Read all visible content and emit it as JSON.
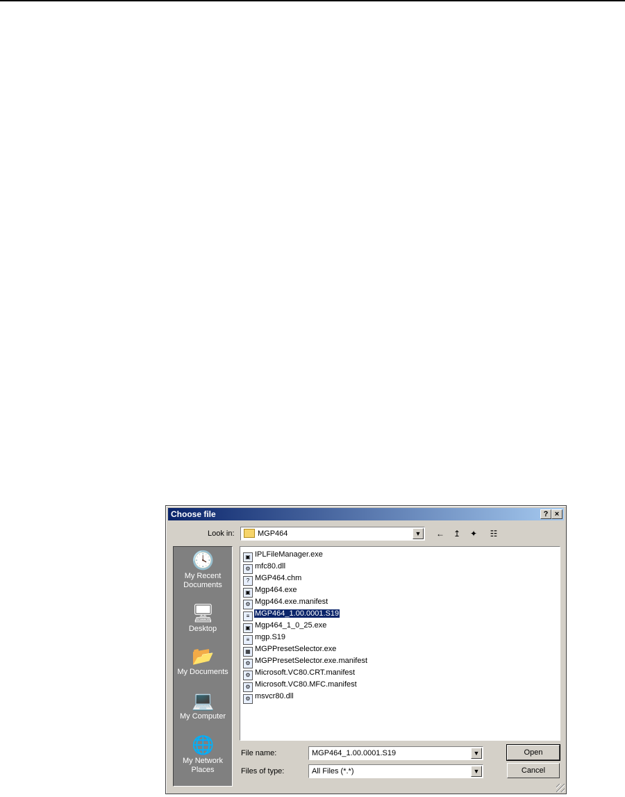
{
  "dialog": {
    "title": "Choose file",
    "help_label": "?",
    "close_label": "×"
  },
  "lookin": {
    "label": "Look in:",
    "value": "MGP464"
  },
  "toolbar": {
    "back_icon": "←",
    "up_icon": "↥",
    "new_folder_icon": "✦",
    "views_icon": "☷"
  },
  "places": [
    {
      "label": "My Recent Documents",
      "icon": "clock-icon"
    },
    {
      "label": "Desktop",
      "icon": "desktop-icon"
    },
    {
      "label": "My Documents",
      "icon": "folder-icon"
    },
    {
      "label": "My Computer",
      "icon": "computer-icon"
    },
    {
      "label": "My Network Places",
      "icon": "globe-icon"
    }
  ],
  "files": [
    {
      "name": "IPLFileManager.exe",
      "icon": "exe"
    },
    {
      "name": "mfc80.dll",
      "icon": "dll"
    },
    {
      "name": "MGP464.chm",
      "icon": "chm"
    },
    {
      "name": "Mgp464.exe",
      "icon": "exe"
    },
    {
      "name": "Mgp464.exe.manifest",
      "icon": "manifest"
    },
    {
      "name": "MGP464_1.00.0001.S19",
      "icon": "s19",
      "selected": true
    },
    {
      "name": "Mgp464_1_0_25.exe",
      "icon": "exe"
    },
    {
      "name": "mgp.S19",
      "icon": "s19"
    },
    {
      "name": "MGPPresetSelector.exe",
      "icon": "exe"
    },
    {
      "name": "MGPPresetSelector.exe.manifest",
      "icon": "manifest"
    },
    {
      "name": "Microsoft.VC80.CRT.manifest",
      "icon": "manifest"
    },
    {
      "name": "Microsoft.VC80.MFC.manifest",
      "icon": "manifest"
    },
    {
      "name": "msvcr80.dll",
      "icon": "dll"
    }
  ],
  "filename": {
    "label": "File name:",
    "value": "MGP464_1.00.0001.S19"
  },
  "filetype": {
    "label": "Files of type:",
    "value": "All Files (*.*)"
  },
  "buttons": {
    "open": "Open",
    "cancel": "Cancel"
  }
}
